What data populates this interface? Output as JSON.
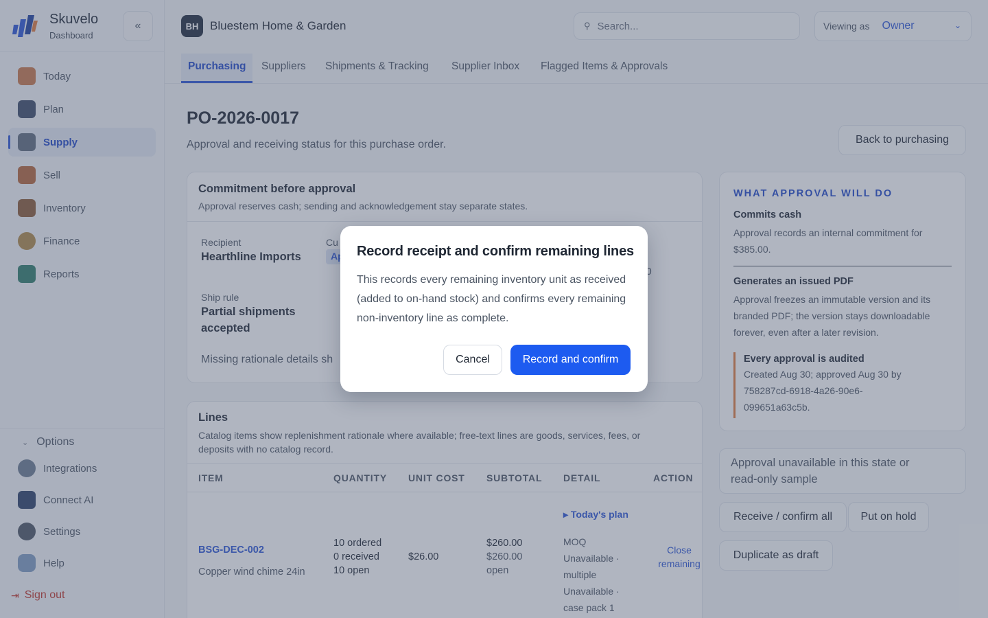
{
  "brand": {
    "name": "Skuvelo",
    "sub": "Dashboard"
  },
  "sidebar": {
    "items": [
      {
        "label": "Today",
        "color": "#c9774a"
      },
      {
        "label": "Plan",
        "color": "#3b4a66"
      },
      {
        "label": "Supply",
        "color": "#5d6a7c"
      },
      {
        "label": "Sell",
        "color": "#b5643a"
      },
      {
        "label": "Inventory",
        "color": "#8a5a36"
      },
      {
        "label": "Finance",
        "color": "#b08948"
      },
      {
        "label": "Reports",
        "color": "#2f7d6b"
      }
    ],
    "options_label": "Options",
    "bottom_items": [
      {
        "label": "Integrations",
        "color": "#6b7a90"
      },
      {
        "label": "Connect AI",
        "color": "#2a3f66"
      },
      {
        "label": "Settings",
        "color": "#4b5563"
      },
      {
        "label": "Help",
        "color": "#7f9cc2"
      }
    ],
    "sign_out": "Sign out"
  },
  "topbar": {
    "org_initials": "BH",
    "org_name": "Bluestem Home & Garden",
    "search_placeholder": "Search...",
    "viewing_label": "Viewing as",
    "viewing_value": "Owner"
  },
  "tabs": [
    "Purchasing",
    "Suppliers",
    "Shipments & Tracking",
    "Supplier Inbox",
    "Flagged Items & Approvals"
  ],
  "page": {
    "title": "PO-2026-0017",
    "subtitle": "Approval and receiving status for this purchase order.",
    "back_button": "Back to purchasing"
  },
  "commitment": {
    "title": "Commitment before approval",
    "subtitle": "Approval reserves cash; sending and acknowledgement stay separate states.",
    "recipient_label": "Recipient",
    "recipient_value": "Hearthline Imports",
    "current_label": "Cu",
    "current_pill": "Ap",
    "right_fragment": "20",
    "ship_rule_label": "Ship rule",
    "ship_rule_value_1": "Partial shipments",
    "ship_rule_value_2": "accepted",
    "note": "Missing rationale details sh"
  },
  "lines": {
    "title": "Lines",
    "subtitle": "Catalog items show replenishment rationale where available; free-text lines are goods, services, fees, or deposits with no catalog record.",
    "headers": [
      "ITEM",
      "QUANTITY",
      "UNIT COST",
      "SUBTOTAL",
      "DETAIL",
      "ACTION"
    ],
    "row": {
      "sku": "BSG-DEC-002",
      "name": "Copper wind chime 24in",
      "ordered": "10 ordered",
      "received": "0 received",
      "open": "10 open",
      "unit_cost": "$26.00",
      "subtotal": "$260.00",
      "subtotal_open_1": "$260.00",
      "subtotal_open_2": "open",
      "detail_toggle": "Today's plan",
      "detail_1": "MOQ",
      "detail_2": "Unavailable ·",
      "detail_3": "multiple",
      "detail_4": "Unavailable ·",
      "detail_5": "case pack 1",
      "action_1": "Close",
      "action_2": "remaining"
    }
  },
  "approval": {
    "heading": "WHAT APPROVAL WILL DO",
    "cash_title": "Commits cash",
    "cash_text_1": "Approval records an internal commitment for",
    "cash_text_2": "$385.00.",
    "pdf_title": "Generates an issued PDF",
    "pdf_text_1": "Approval freezes an immutable version and its",
    "pdf_text_2": "branded PDF; the version stays downloadable",
    "pdf_text_3": "forever, even after a later revision.",
    "audit_title": "Every approval is audited",
    "audit_text_1": "Created Aug 30; approved Aug 30 by",
    "audit_text_2": "758287cd-6918-4a26-90e6-",
    "audit_text_3": "099651a63c5b."
  },
  "actions": {
    "status_line_1": "Approval unavailable in this state or",
    "status_line_2": "read-only sample",
    "receive_all": "Receive / confirm all",
    "put_on_hold": "Put on hold",
    "duplicate": "Duplicate as draft"
  },
  "modal": {
    "title": "Record receipt and confirm remaining lines",
    "body": "This records every remaining inventory unit as received (added to on-hand stock) and confirms every remaining non-inventory line as complete.",
    "cancel": "Cancel",
    "confirm": "Record and confirm"
  }
}
